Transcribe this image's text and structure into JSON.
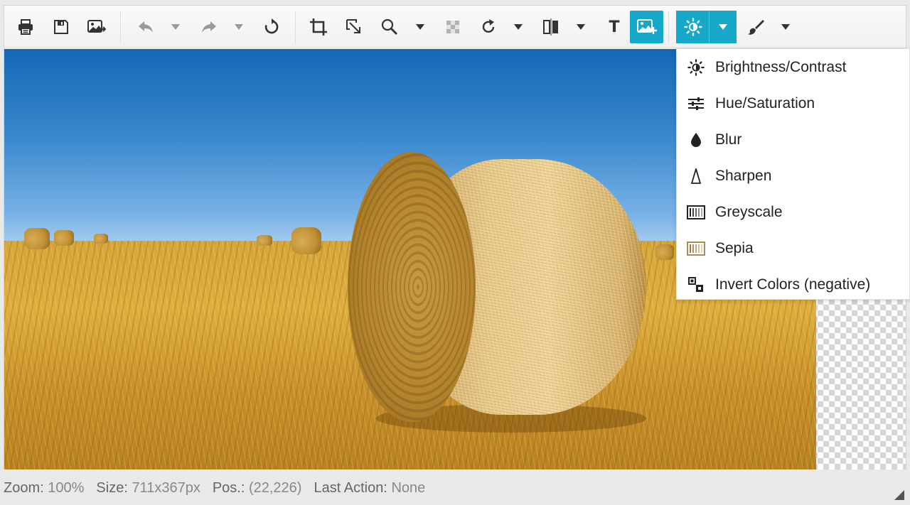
{
  "toolbar": {
    "buttons": [
      {
        "name": "print-button",
        "icon": "print-icon"
      },
      {
        "name": "save-button",
        "icon": "save-icon"
      },
      {
        "name": "export-image-button",
        "icon": "image-export-icon"
      },
      {
        "name": "undo-button",
        "icon": "undo-icon"
      },
      {
        "name": "undo-dropdown",
        "icon": "chevron-down-icon"
      },
      {
        "name": "redo-button",
        "icon": "redo-icon"
      },
      {
        "name": "redo-dropdown",
        "icon": "chevron-down-icon"
      },
      {
        "name": "reset-button",
        "icon": "reset-icon"
      },
      {
        "name": "crop-button",
        "icon": "crop-icon"
      },
      {
        "name": "resize-button",
        "icon": "resize-icon"
      },
      {
        "name": "zoom-button",
        "icon": "zoom-icon"
      },
      {
        "name": "zoom-dropdown",
        "icon": "chevron-down-icon"
      },
      {
        "name": "transparency-button",
        "icon": "checkerboard-icon"
      },
      {
        "name": "rotate-button",
        "icon": "rotate-icon"
      },
      {
        "name": "rotate-dropdown",
        "icon": "chevron-down-icon"
      },
      {
        "name": "flip-button",
        "icon": "flip-icon"
      },
      {
        "name": "flip-dropdown",
        "icon": "chevron-down-icon"
      },
      {
        "name": "text-button",
        "icon": "text-icon",
        "label": "T"
      },
      {
        "name": "insert-image-button",
        "icon": "image-add-icon"
      },
      {
        "name": "filters-button",
        "icon": "brightness-icon"
      },
      {
        "name": "filters-dropdown",
        "icon": "chevron-down-icon"
      },
      {
        "name": "draw-button",
        "icon": "brush-icon"
      },
      {
        "name": "draw-dropdown",
        "icon": "chevron-down-icon"
      }
    ]
  },
  "filter_menu": {
    "items": [
      {
        "label": "Brightness/Contrast",
        "icon": "brightness-icon"
      },
      {
        "label": "Hue/Saturation",
        "icon": "sliders-icon"
      },
      {
        "label": "Blur",
        "icon": "drop-icon"
      },
      {
        "label": "Sharpen",
        "icon": "sharpen-icon"
      },
      {
        "label": "Greyscale",
        "icon": "greyscale-icon"
      },
      {
        "label": "Sepia",
        "icon": "sepia-icon"
      },
      {
        "label": "Invert Colors (negative)",
        "icon": "invert-icon"
      }
    ]
  },
  "status": {
    "zoom_label": "Zoom:",
    "zoom_value": "100%",
    "size_label": "Size:",
    "size_value": "711x367px",
    "pos_label": "Pos.:",
    "pos_value": "(22,226)",
    "action_label": "Last Action:",
    "action_value": "None"
  },
  "colors": {
    "accent": "#17a8c9",
    "toolbar_bg": "#f3f3f3",
    "icon": "#333333",
    "icon_disabled": "#9a9a9a"
  }
}
